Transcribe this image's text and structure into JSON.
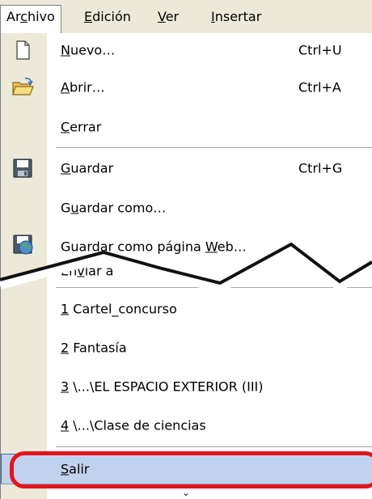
{
  "menubar": {
    "items": [
      {
        "pre": "Ar",
        "key": "c",
        "post": "hivo"
      },
      {
        "pre": "",
        "key": "E",
        "post": "dición"
      },
      {
        "pre": "",
        "key": "V",
        "post": "er"
      },
      {
        "pre": "",
        "key": "I",
        "post": "nsertar"
      }
    ]
  },
  "menu": {
    "nuevo": {
      "pre": "",
      "key": "N",
      "post": "uevo…",
      "shortcut": "Ctrl+U"
    },
    "abrir": {
      "pre": "",
      "key": "A",
      "post": "brir…",
      "shortcut": "Ctrl+A"
    },
    "cerrar": {
      "pre": "",
      "key": "C",
      "post": "errar"
    },
    "guardar": {
      "pre": "",
      "key": "G",
      "post": "uardar",
      "shortcut": "Ctrl+G"
    },
    "guardar_como": {
      "pre": "G",
      "key": "u",
      "post": "ardar como…"
    },
    "guardar_web": {
      "pre": "Guardar como página ",
      "key": "W",
      "post": "eb…"
    },
    "enviar": {
      "pre": "En",
      "key": "v",
      "post": "iar a"
    },
    "recent": [
      {
        "key": "1",
        "post": " Cartel_concurso"
      },
      {
        "key": "2",
        "post": " Fantasía"
      },
      {
        "key": "3",
        "post": " \\...\\EL ESPACIO EXTERIOR (III)"
      },
      {
        "key": "4",
        "post": " \\...\\Clase de ciencias"
      }
    ],
    "salir": {
      "pre": "",
      "key": "S",
      "post": "alir"
    }
  },
  "icons": {
    "nuevo": "new-document-icon",
    "abrir": "open-folder-icon",
    "guardar": "save-disk-icon",
    "guardar_web": "save-web-icon"
  },
  "colors": {
    "highlight": "#c1d2ee",
    "highlight_border": "#316ac5",
    "annotation": "#e4131b"
  }
}
